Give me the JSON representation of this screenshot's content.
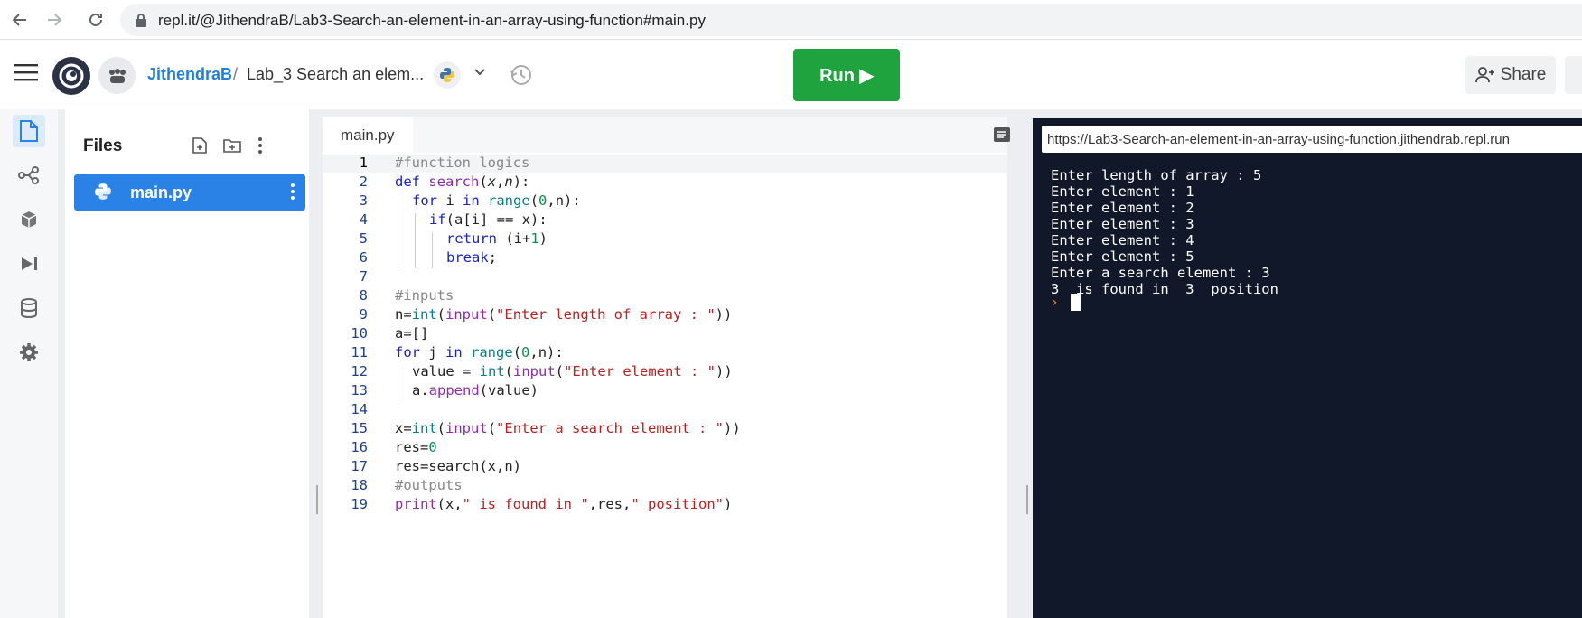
{
  "browser": {
    "url": "repl.it/@JithendraB/Lab3-Search-an-element-in-an-array-using-function#main.py"
  },
  "header": {
    "username": "JithendraB",
    "separator": "/",
    "project_name": "Lab_3 Search an elem...",
    "run_label": "Run ▶",
    "share_label": "Share"
  },
  "files": {
    "title": "Files",
    "items": [
      {
        "name": "main.py"
      }
    ]
  },
  "editor": {
    "tab_label": "main.py",
    "line_numbers": [
      "1",
      "2",
      "3",
      "4",
      "5",
      "6",
      "7",
      "8",
      "9",
      "10",
      "11",
      "12",
      "13",
      "14",
      "15",
      "16",
      "17",
      "18",
      "19"
    ],
    "lines": [
      "#function logics",
      "def search(x,n):",
      "for i in range(0,n):",
      "if(a[i] == x):",
      "return (i+1)",
      "break;",
      "",
      "#inputs",
      "n=int(input(\"Enter length of array : \"))",
      "a=[]",
      "for j in range(0,n):",
      "value = int(input(\"Enter element : \"))",
      "a.append(value)",
      "",
      "x=int(input(\"Enter a search element : \"))",
      "res=0",
      "res=search(x,n)",
      "#outputs",
      "print(x,\" is found in \",res,\" position\")"
    ]
  },
  "console": {
    "url": "https://Lab3-Search-an-element-in-an-array-using-function.jithendrab.repl.run",
    "output": [
      "Enter length of array : 5",
      "Enter element : 1",
      "Enter element : 2",
      "Enter element : 3",
      "Enter element : 4",
      "Enter element : 5",
      "Enter a search element : 3",
      "3  is found in  3  position"
    ],
    "prompt": "›"
  },
  "colors": {
    "run_green": "#1fa33f",
    "selected_file_blue": "#2b82e6",
    "console_bg": "#111829",
    "username_blue": "#1e7fdf"
  }
}
